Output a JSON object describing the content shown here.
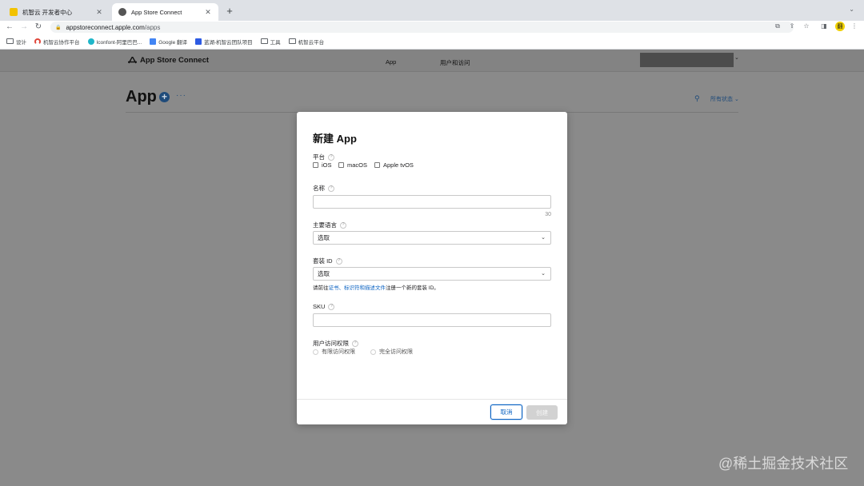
{
  "browser": {
    "tabs": [
      {
        "title": "机智云 开发者中心",
        "favicon_color": "#f2c200",
        "active": false
      },
      {
        "title": "App Store Connect",
        "favicon_color": "#555555",
        "active": true
      }
    ],
    "new_tab": "+",
    "address": {
      "host": "appstoreconnect.apple.com",
      "path": "/apps"
    },
    "bookmarks": [
      {
        "label": "设计",
        "icon": "folder-icon"
      },
      {
        "label": "机智云协作平台",
        "icon": "arc-icon"
      },
      {
        "label": "Iconfont-阿里巴巴...",
        "icon": "iconfont-icon"
      },
      {
        "label": "Google 翻译",
        "icon": "translate-icon"
      },
      {
        "label": "蓝湖-机智云团队项目",
        "icon": "lanhu-icon"
      },
      {
        "label": "工具",
        "icon": "folder-icon"
      },
      {
        "label": "机智云平台",
        "icon": "folder-icon"
      }
    ],
    "extension_label": "翻"
  },
  "asc": {
    "logo_text": "App Store Connect",
    "nav": [
      "App",
      "用户和访问"
    ],
    "page_title": "App",
    "add": "+",
    "more": "···",
    "status_filter": "所有状态"
  },
  "modal": {
    "title": "新建 App",
    "platform": {
      "label": "平台",
      "options": [
        "iOS",
        "macOS",
        "Apple tvOS"
      ]
    },
    "name": {
      "label": "名称",
      "value": "",
      "counter": "30"
    },
    "language": {
      "label": "主要语言",
      "value": "选取"
    },
    "bundle": {
      "label": "套装 ID",
      "value": "选取",
      "hint_prefix": "请前往",
      "hint_link": "证书、标识符和描述文件",
      "hint_suffix": "注册一个新的套装 ID。"
    },
    "sku": {
      "label": "SKU",
      "value": ""
    },
    "access": {
      "label": "用户访问权限",
      "options": [
        "有限访问权限",
        "完全访问权限"
      ]
    },
    "cancel": "取消",
    "create": "创建"
  },
  "help_glyph": "?",
  "watermark": "@稀土掘金技术社区"
}
